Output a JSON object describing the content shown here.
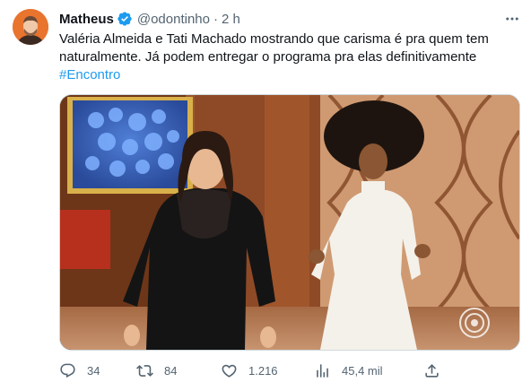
{
  "author": {
    "name": "Matheus",
    "handle": "@odontinho",
    "separator": "·",
    "time": "2 h",
    "avatar_color": "#e8742e",
    "verified_color": "#1d9bf0"
  },
  "tweet": {
    "line1": "Valéria Almeida e Tati Machado mostrando que carisma é pra quem tem",
    "line2": "naturalmente. Já podem entregar o programa pra elas definitivamente",
    "hashtag": "#Encontro"
  },
  "media": {
    "kind": "photo",
    "icons": [
      "broadcaster-watermark-icon"
    ]
  },
  "actions": {
    "replies": "34",
    "retweets": "84",
    "likes": "1.216",
    "views": "45,4 mil"
  },
  "icons": [
    "more-icon",
    "verified-icon",
    "reply-icon",
    "retweet-icon",
    "like-icon",
    "views-icon",
    "share-icon"
  ]
}
